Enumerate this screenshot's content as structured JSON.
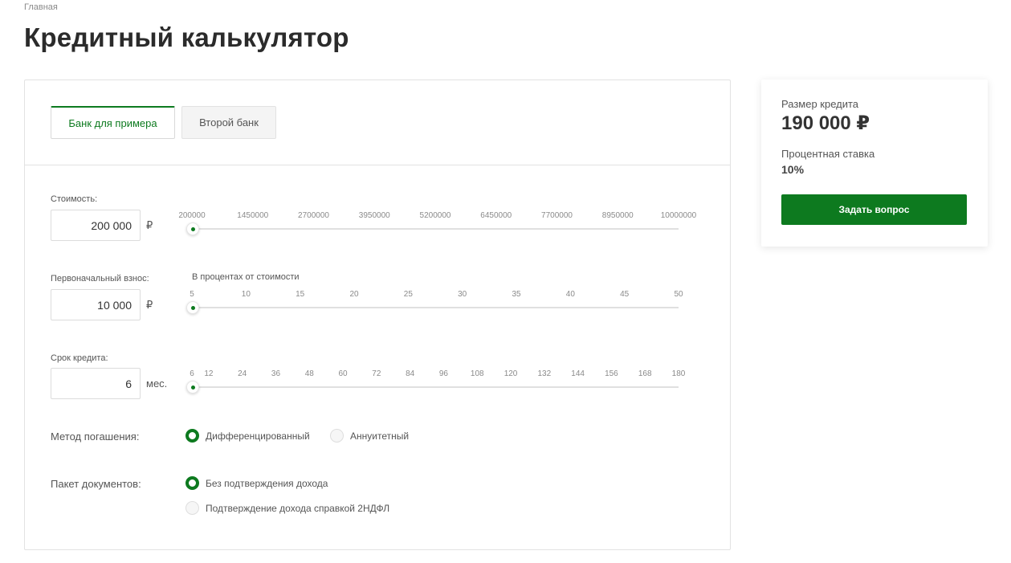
{
  "breadcrumb": "Главная",
  "title": "Кредитный калькулятор",
  "tabs": [
    {
      "label": "Банк для примера",
      "active": true
    },
    {
      "label": "Второй банк",
      "active": false
    }
  ],
  "cost": {
    "label": "Стоимость:",
    "value": "200 000",
    "unit": "₽",
    "ticks": [
      "200000",
      "1450000",
      "2700000",
      "3950000",
      "5200000",
      "6450000",
      "7700000",
      "8950000",
      "10000000"
    ],
    "min": 200000,
    "max": 10000000,
    "current": 200000
  },
  "down_payment": {
    "label": "Первоначальный взнос:",
    "sublabel": "В процентах от стоимости",
    "value": "10 000",
    "unit": "₽",
    "ticks": [
      "5",
      "10",
      "15",
      "20",
      "25",
      "30",
      "35",
      "40",
      "45",
      "50"
    ],
    "min": 5,
    "max": 50,
    "current": 5
  },
  "term": {
    "label": "Срок кредита:",
    "value": "6",
    "unit": "мес.",
    "ticks": [
      "6",
      "12",
      "24",
      "36",
      "48",
      "60",
      "72",
      "84",
      "96",
      "108",
      "120",
      "132",
      "144",
      "156",
      "168",
      "180"
    ],
    "min": 6,
    "max": 180,
    "current": 6
  },
  "repayment": {
    "label": "Метод погашения:",
    "options": [
      {
        "label": "Дифференцированный",
        "selected": true
      },
      {
        "label": "Аннуитетный",
        "selected": false
      }
    ]
  },
  "documents": {
    "label": "Пакет документов:",
    "options": [
      {
        "label": "Без подтверждения дохода",
        "selected": true
      },
      {
        "label": "Подтверждение дохода справкой 2НДФЛ",
        "selected": false
      }
    ]
  },
  "summary": {
    "loan_label": "Размер кредита",
    "loan_amount": "190 000 ₽",
    "rate_label": "Процентная ставка",
    "rate_value": "10%",
    "button_label": "Задать вопрос"
  },
  "colors": {
    "accent": "#0d7a1f"
  }
}
